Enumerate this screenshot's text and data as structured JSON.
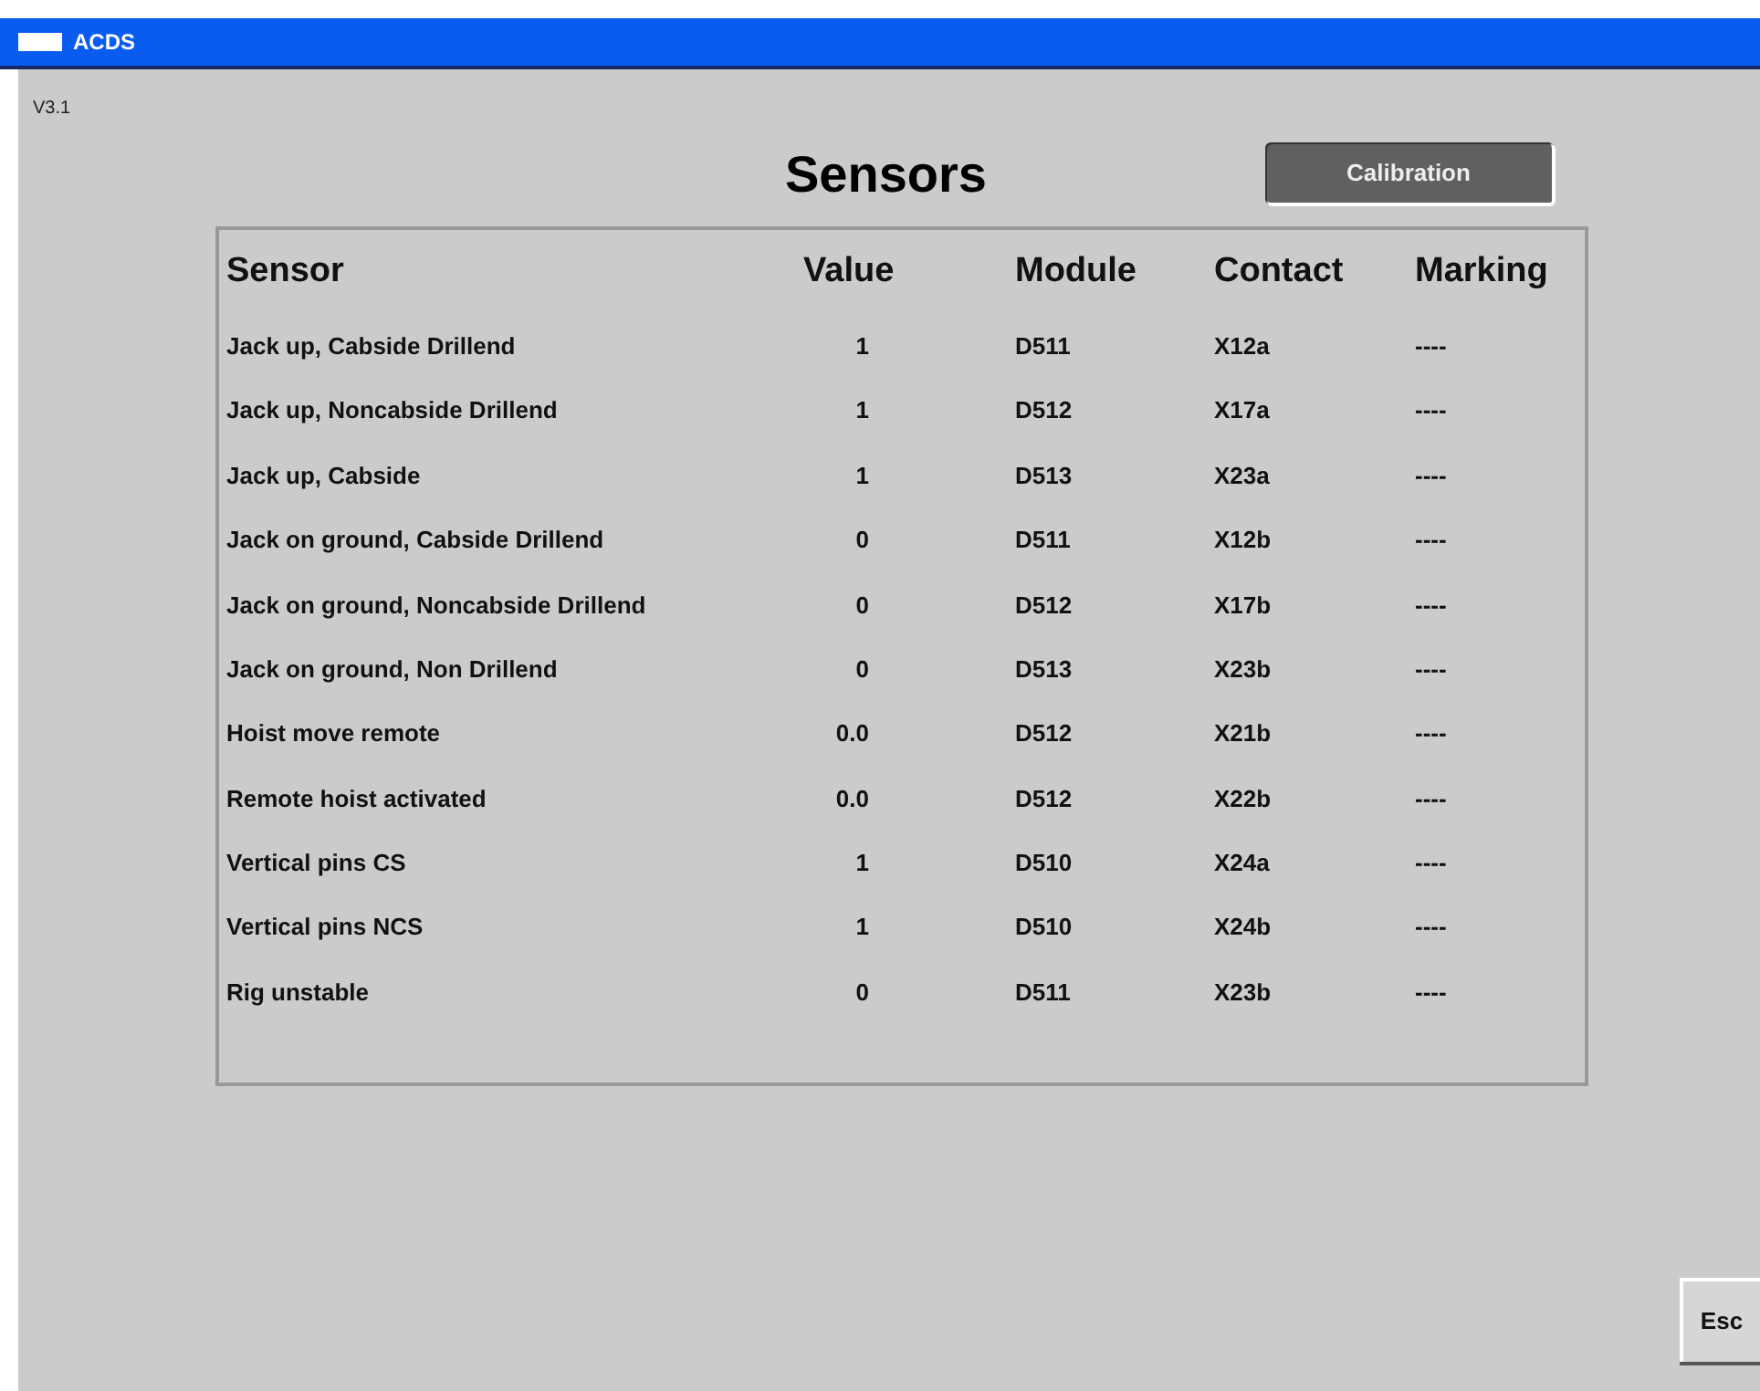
{
  "window": {
    "title": "ACDS"
  },
  "version": "V3.1",
  "heading": "Sensors",
  "calibration_button": "Calibration",
  "table": {
    "columns": [
      "Sensor",
      "Value",
      "Module",
      "Contact",
      "Marking"
    ],
    "rows": [
      [
        "Jack up, Cabside Drillend",
        "1",
        "D511",
        "X12a",
        "----"
      ],
      [
        "Jack up, Noncabside Drillend",
        "1",
        "D512",
        "X17a",
        "----"
      ],
      [
        "Jack up, Cabside",
        "1",
        "D513",
        "X23a",
        "----"
      ],
      [
        "Jack on ground, Cabside Drillend",
        "0",
        "D511",
        "X12b",
        "----"
      ],
      [
        "Jack on ground, Noncabside Drillend",
        "0",
        "D512",
        "X17b",
        "----"
      ],
      [
        "Jack on ground, Non Drillend",
        "0",
        "D513",
        "X23b",
        "----"
      ],
      [
        "Hoist move remote",
        "0.0",
        "D512",
        "X21b",
        "----"
      ],
      [
        "Remote hoist activated",
        "0.0",
        "D512",
        "X22b",
        "----"
      ],
      [
        "Vertical pins CS",
        "1",
        "D510",
        "X24a",
        "----"
      ],
      [
        "Vertical pins NCS",
        "1",
        "D510",
        "X24b",
        "----"
      ],
      [
        "Rig unstable",
        "0",
        "D511",
        "X23b",
        "----"
      ]
    ]
  },
  "esc_button": "Esc"
}
